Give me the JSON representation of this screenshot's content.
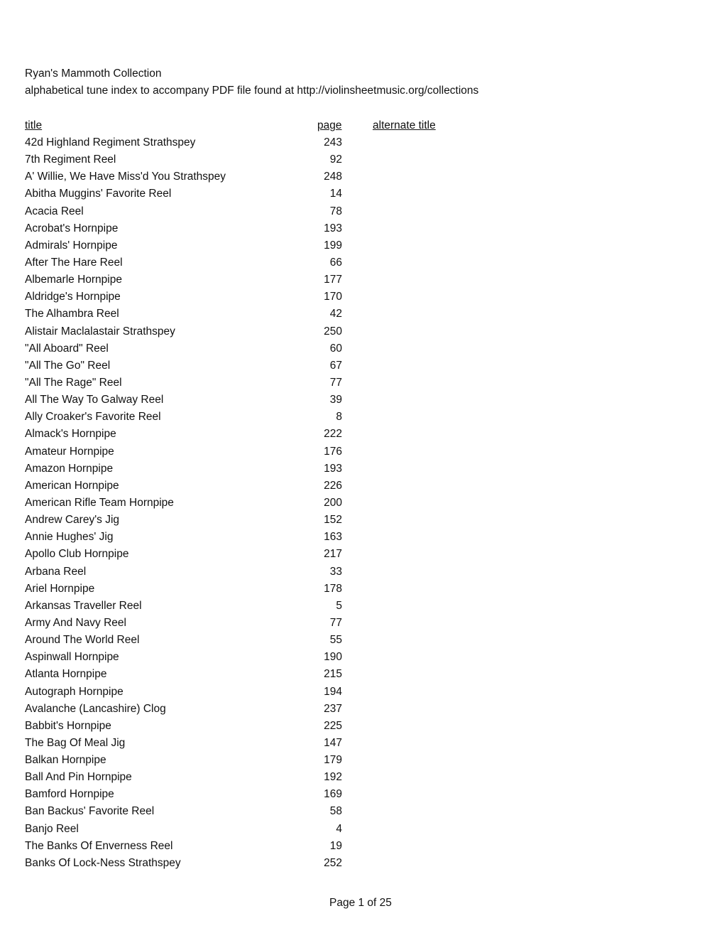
{
  "document": {
    "title": "Ryan's Mammoth Collection",
    "subtitle": "alphabetical tune index to accompany PDF file found at  http://violinsheetmusic.org/collections"
  },
  "table": {
    "headers": {
      "title": "title",
      "page": "page",
      "alternate_title": "alternate title"
    },
    "rows": [
      {
        "title": "42d Highland Regiment Strathspey",
        "page": "243",
        "alt": ""
      },
      {
        "title": "7th Regiment Reel",
        "page": "92",
        "alt": ""
      },
      {
        "title": "A' Willie, We Have Miss'd You Strathspey",
        "page": "248",
        "alt": ""
      },
      {
        "title": "Abitha Muggins' Favorite Reel",
        "page": "14",
        "alt": ""
      },
      {
        "title": "Acacia Reel",
        "page": "78",
        "alt": ""
      },
      {
        "title": "Acrobat's Hornpipe",
        "page": "193",
        "alt": ""
      },
      {
        "title": "Admirals' Hornpipe",
        "page": "199",
        "alt": ""
      },
      {
        "title": "After The Hare Reel",
        "page": "66",
        "alt": ""
      },
      {
        "title": "Albemarle Hornpipe",
        "page": "177",
        "alt": ""
      },
      {
        "title": "Aldridge's Hornpipe",
        "page": "170",
        "alt": ""
      },
      {
        "title": "The Alhambra Reel",
        "page": "42",
        "alt": ""
      },
      {
        "title": "Alistair Maclalastair Strathspey",
        "page": "250",
        "alt": ""
      },
      {
        "title": "\"All Aboard\" Reel",
        "page": "60",
        "alt": ""
      },
      {
        "title": "\"All The Go\" Reel",
        "page": "67",
        "alt": ""
      },
      {
        "title": "\"All The Rage\" Reel",
        "page": "77",
        "alt": ""
      },
      {
        "title": "All The Way To Galway Reel",
        "page": "39",
        "alt": ""
      },
      {
        "title": "Ally Croaker's Favorite Reel",
        "page": "8",
        "alt": ""
      },
      {
        "title": "Almack's Hornpipe",
        "page": "222",
        "alt": ""
      },
      {
        "title": "Amateur Hornpipe",
        "page": "176",
        "alt": ""
      },
      {
        "title": "Amazon Hornpipe",
        "page": "193",
        "alt": ""
      },
      {
        "title": "American Hornpipe",
        "page": "226",
        "alt": ""
      },
      {
        "title": "American Rifle Team Hornpipe",
        "page": "200",
        "alt": ""
      },
      {
        "title": "Andrew Carey's Jig",
        "page": "152",
        "alt": ""
      },
      {
        "title": "Annie Hughes' Jig",
        "page": "163",
        "alt": ""
      },
      {
        "title": "Apollo Club Hornpipe",
        "page": "217",
        "alt": ""
      },
      {
        "title": "Arbana Reel",
        "page": "33",
        "alt": ""
      },
      {
        "title": "Ariel Hornpipe",
        "page": "178",
        "alt": ""
      },
      {
        "title": "Arkansas Traveller Reel",
        "page": "5",
        "alt": ""
      },
      {
        "title": "Army And Navy Reel",
        "page": "77",
        "alt": ""
      },
      {
        "title": "Around The World Reel",
        "page": "55",
        "alt": ""
      },
      {
        "title": "Aspinwall Hornpipe",
        "page": "190",
        "alt": ""
      },
      {
        "title": "Atlanta Hornpipe",
        "page": "215",
        "alt": ""
      },
      {
        "title": "Autograph Hornpipe",
        "page": "194",
        "alt": ""
      },
      {
        "title": "Avalanche (Lancashire) Clog",
        "page": "237",
        "alt": ""
      },
      {
        "title": "Babbit's Hornpipe",
        "page": "225",
        "alt": ""
      },
      {
        "title": "The Bag Of Meal Jig",
        "page": "147",
        "alt": ""
      },
      {
        "title": "Balkan Hornpipe",
        "page": "179",
        "alt": ""
      },
      {
        "title": "Ball And Pin Hornpipe",
        "page": "192",
        "alt": ""
      },
      {
        "title": "Bamford Hornpipe",
        "page": "169",
        "alt": ""
      },
      {
        "title": "Ban Backus' Favorite Reel",
        "page": "58",
        "alt": ""
      },
      {
        "title": "Banjo Reel",
        "page": "4",
        "alt": ""
      },
      {
        "title": "The Banks Of Enverness Reel",
        "page": "19",
        "alt": ""
      },
      {
        "title": "Banks Of Lock-Ness Strathspey",
        "page": "252",
        "alt": ""
      }
    ]
  },
  "footer": {
    "page_label": "Page 1 of 25"
  }
}
